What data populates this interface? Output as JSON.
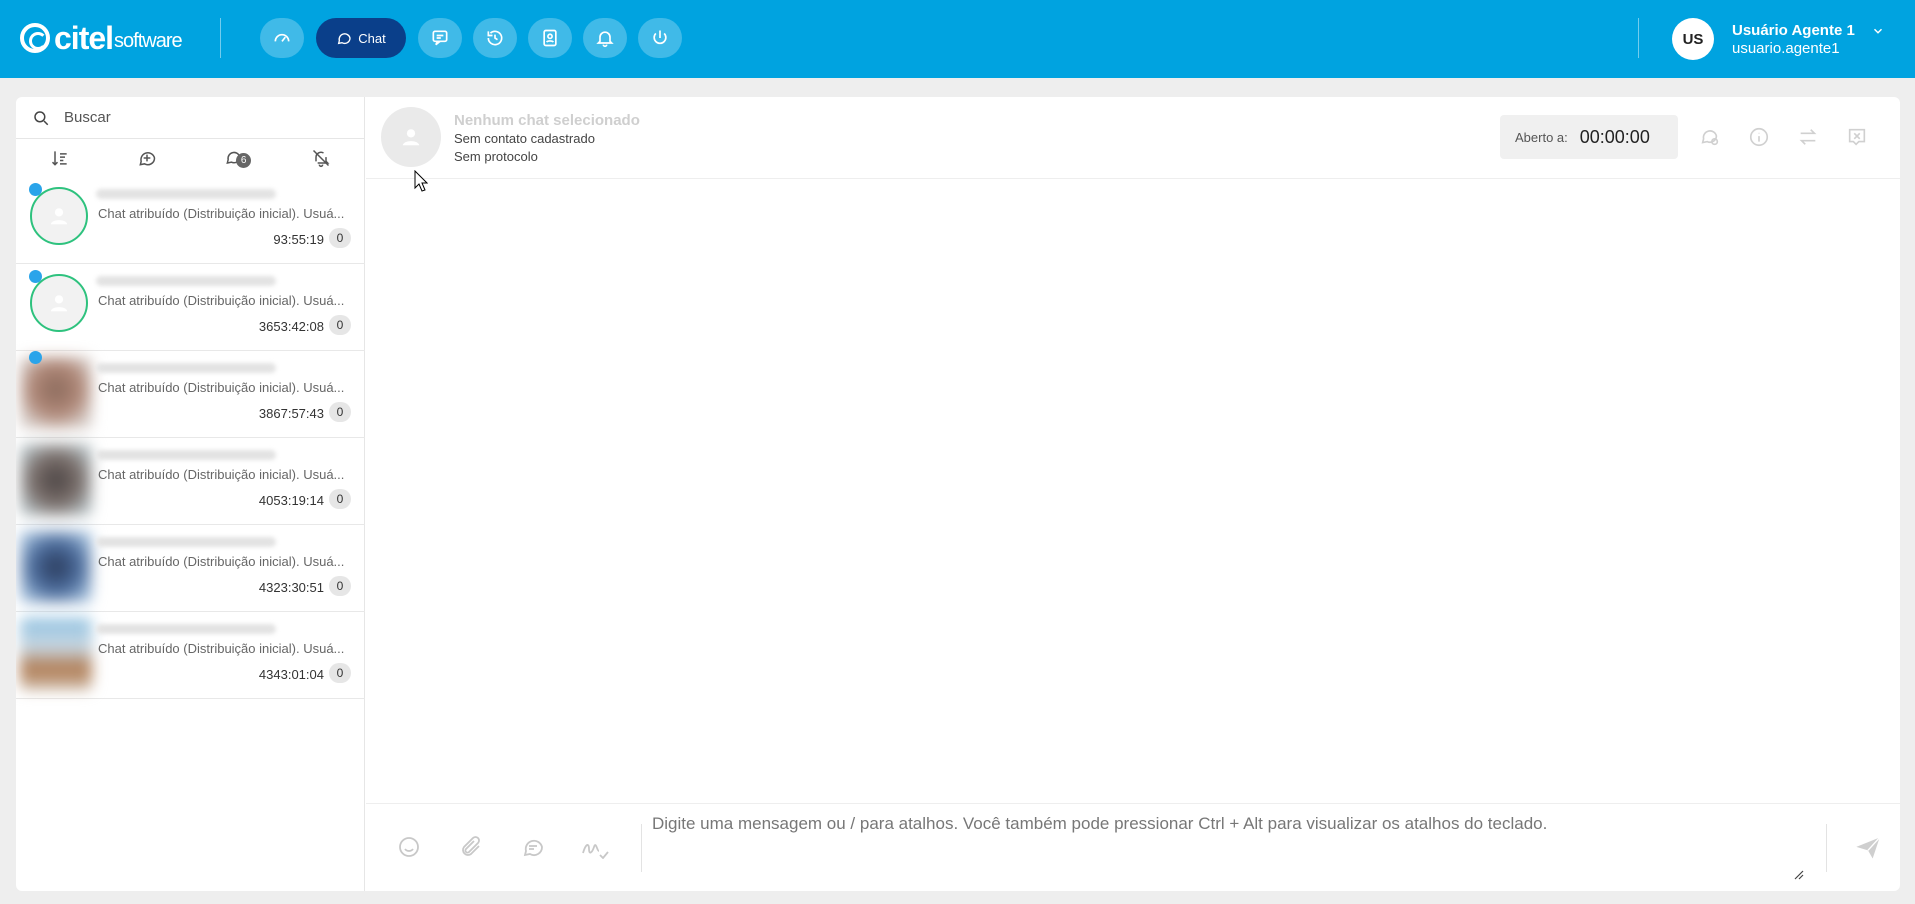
{
  "brand": {
    "name": "citel",
    "suffix": "software"
  },
  "nav": {
    "items": [
      {
        "icon": "dashboard-icon"
      },
      {
        "icon": "chat-icon",
        "label": "Chat",
        "active": true
      },
      {
        "icon": "message-square-icon"
      },
      {
        "icon": "history-icon"
      },
      {
        "icon": "contacts-icon"
      },
      {
        "icon": "bell-icon"
      },
      {
        "icon": "power-icon"
      }
    ]
  },
  "user": {
    "initials": "US",
    "name": "Usuário Agente 1",
    "login": "usuario.agente1"
  },
  "sidebar": {
    "search_placeholder": "Buscar",
    "filters": [
      {
        "icon": "sort-icon"
      },
      {
        "icon": "new-chat-icon"
      },
      {
        "icon": "chats-icon",
        "badge": "6"
      },
      {
        "icon": "bell-off-icon"
      }
    ],
    "chats": [
      {
        "preview": "Chat atribuído (Distribuição inicial). Usuá...",
        "time": "93:55:19",
        "count": "0",
        "unread": true
      },
      {
        "preview": "Chat atribuído (Distribuição inicial). Usuá...",
        "time": "3653:42:08",
        "count": "0",
        "unread": true
      },
      {
        "preview": "Chat atribuído (Distribuição inicial). Usuá...",
        "time": "3867:57:43",
        "count": "0",
        "unread": true
      },
      {
        "preview": "Chat atribuído (Distribuição inicial). Usuá...",
        "time": "4053:19:14",
        "count": "0",
        "unread": false
      },
      {
        "preview": "Chat atribuído (Distribuição inicial). Usuá...",
        "time": "4323:30:51",
        "count": "0",
        "unread": false
      },
      {
        "preview": "Chat atribuído (Distribuição inicial). Usuá...",
        "time": "4343:01:04",
        "count": "0",
        "unread": false
      }
    ]
  },
  "chat_header": {
    "title": "Nenhum chat selecionado",
    "contact": "Sem contato cadastrado",
    "protocol": "Sem protocolo",
    "open_label": "Aberto a:",
    "open_time": "00:00:00"
  },
  "composer": {
    "placeholder": "Digite uma mensagem ou / para atalhos. Você também pode pressionar Ctrl + Alt para visualizar os atalhos do teclado."
  },
  "colors": {
    "topbar": "#00a3e0",
    "active_nav": "#0a3f8a",
    "online_ring": "#2ec27e",
    "unread_dot": "#2aa4ea"
  }
}
